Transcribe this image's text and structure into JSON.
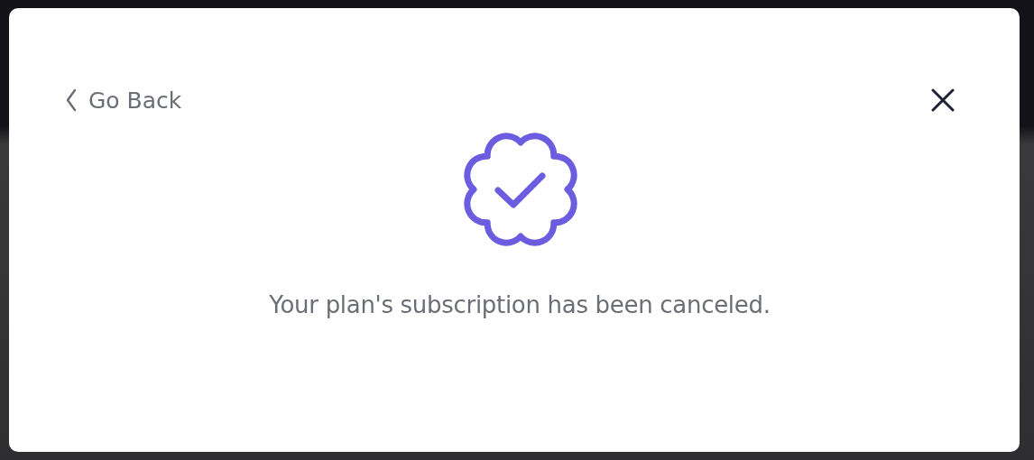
{
  "back_link": {
    "label": "Go Back"
  },
  "message": "Your plan's subscription has been canceled."
}
